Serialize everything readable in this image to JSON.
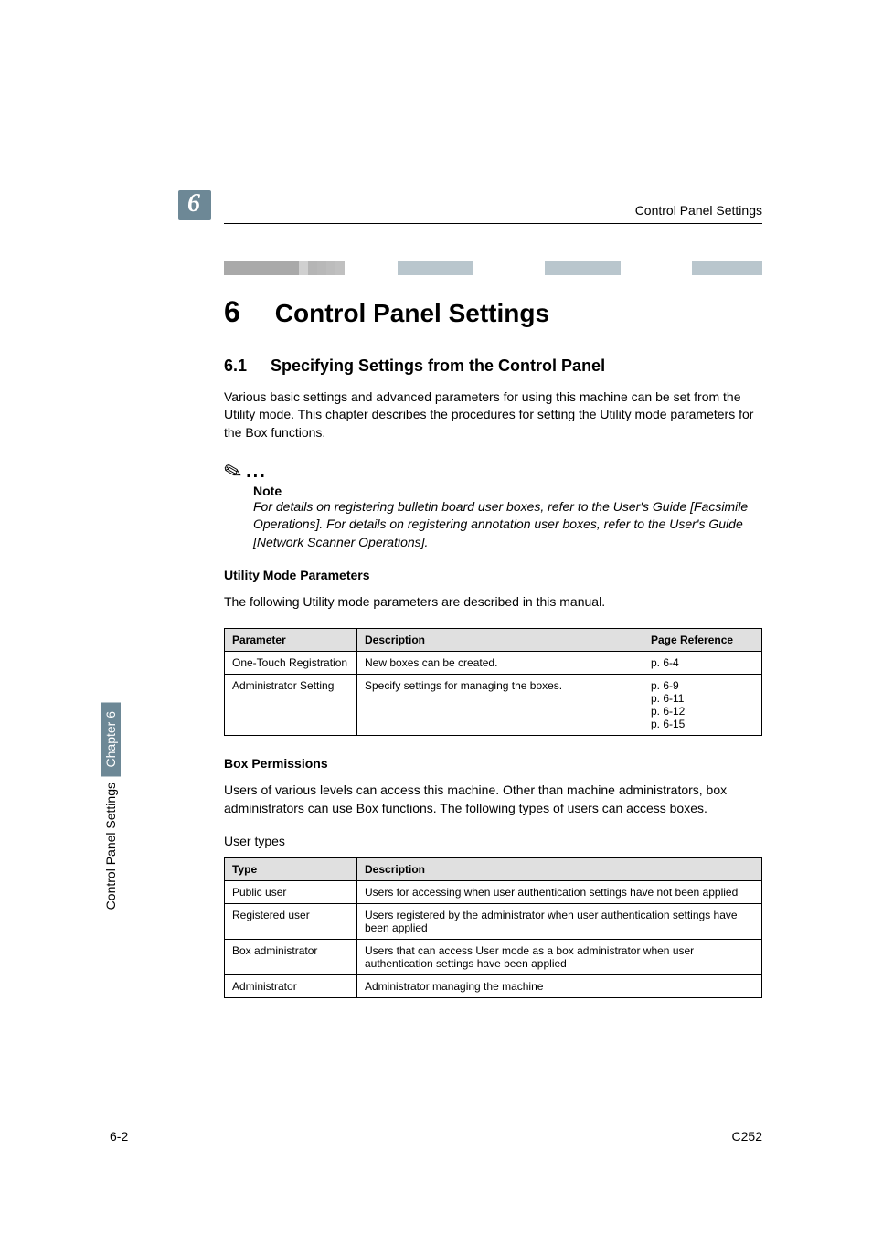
{
  "header": {
    "chapter_badge": "6",
    "running_title": "Control Panel Settings"
  },
  "chapter_title": {
    "number": "6",
    "text": "Control Panel Settings"
  },
  "section": {
    "number": "6.1",
    "title": "Specifying Settings from the Control Panel",
    "intro": "Various basic settings and advanced parameters for using this machine can be set from the Utility mode. This chapter describes the procedures for setting the Utility mode parameters for the Box functions."
  },
  "note": {
    "heading": "Note",
    "body": "For details on registering bulletin board user boxes, refer to the User's Guide [Facsimile Operations]. For details on registering annotation user boxes, refer to the User's Guide [Network Scanner Operations]."
  },
  "utility": {
    "heading": "Utility Mode Parameters",
    "intro": "The following Utility mode parameters are described in this manual.",
    "headers": {
      "c1": "Parameter",
      "c2": "Description",
      "c3": "Page Reference"
    },
    "rows": [
      {
        "c1": "One-Touch Registration",
        "c2": "New boxes can be created.",
        "c3": "p. 6-4"
      },
      {
        "c1": "Administrator Setting",
        "c2": "Specify settings for managing the boxes.",
        "c3": "p. 6-9\np. 6-11\np. 6-12\np. 6-15"
      }
    ]
  },
  "permissions": {
    "heading": "Box Permissions",
    "intro": "Users of various levels can access this machine. Other than machine administrators, box administrators can use Box functions. The following types of users can access boxes.",
    "user_types_label": "User types",
    "headers": {
      "c1": "Type",
      "c2": "Description"
    },
    "rows": [
      {
        "c1": "Public user",
        "c2": "Users for accessing when user authentication settings have not been applied"
      },
      {
        "c1": "Registered user",
        "c2": "Users registered by the administrator when user authentication settings have been applied"
      },
      {
        "c1": "Box administrator",
        "c2": "Users that can access User mode as a box administrator when user authentication settings have been applied"
      },
      {
        "c1": "Administrator",
        "c2": "Administrator managing the machine"
      }
    ]
  },
  "sidebar": {
    "chapter": "Chapter 6",
    "title": "Control Panel Settings"
  },
  "footer": {
    "left": "6-2",
    "right": "C252"
  }
}
